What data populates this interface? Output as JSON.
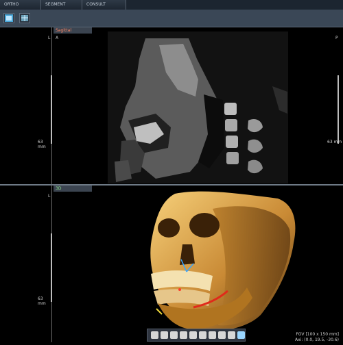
{
  "tabs": [
    "ORTHO",
    "SEGMENT",
    "CONSULT"
  ],
  "toolbar": {
    "buttons": [
      "view-toggle-icon",
      "layers-icon"
    ]
  },
  "sagittal": {
    "title": "Sagittal",
    "left_tag": "L",
    "view_tag": "A",
    "right_tag": "P",
    "scale_left": "63 mm",
    "scale_right": "63 mm"
  },
  "view3d": {
    "title": "3D",
    "left_tag": "L",
    "scale_left": "63 mm",
    "fov_line1": "FOV [100 x 150 mm]",
    "fov_line2": "Axi: (0.0, 19.5, -30.6)"
  },
  "dock_tools": [
    "rotate-icon",
    "hand-icon",
    "hand-icon",
    "hand-icon",
    "hand-icon",
    "skull-icon",
    "skull-icon",
    "skull-icon",
    "skull-icon",
    "skull-icon"
  ],
  "colors": {
    "ui_dark": "#1c2530",
    "toolbar": "#3a4756",
    "sagittal_title": "#ff8866",
    "view3d_title": "#8fe08f"
  }
}
